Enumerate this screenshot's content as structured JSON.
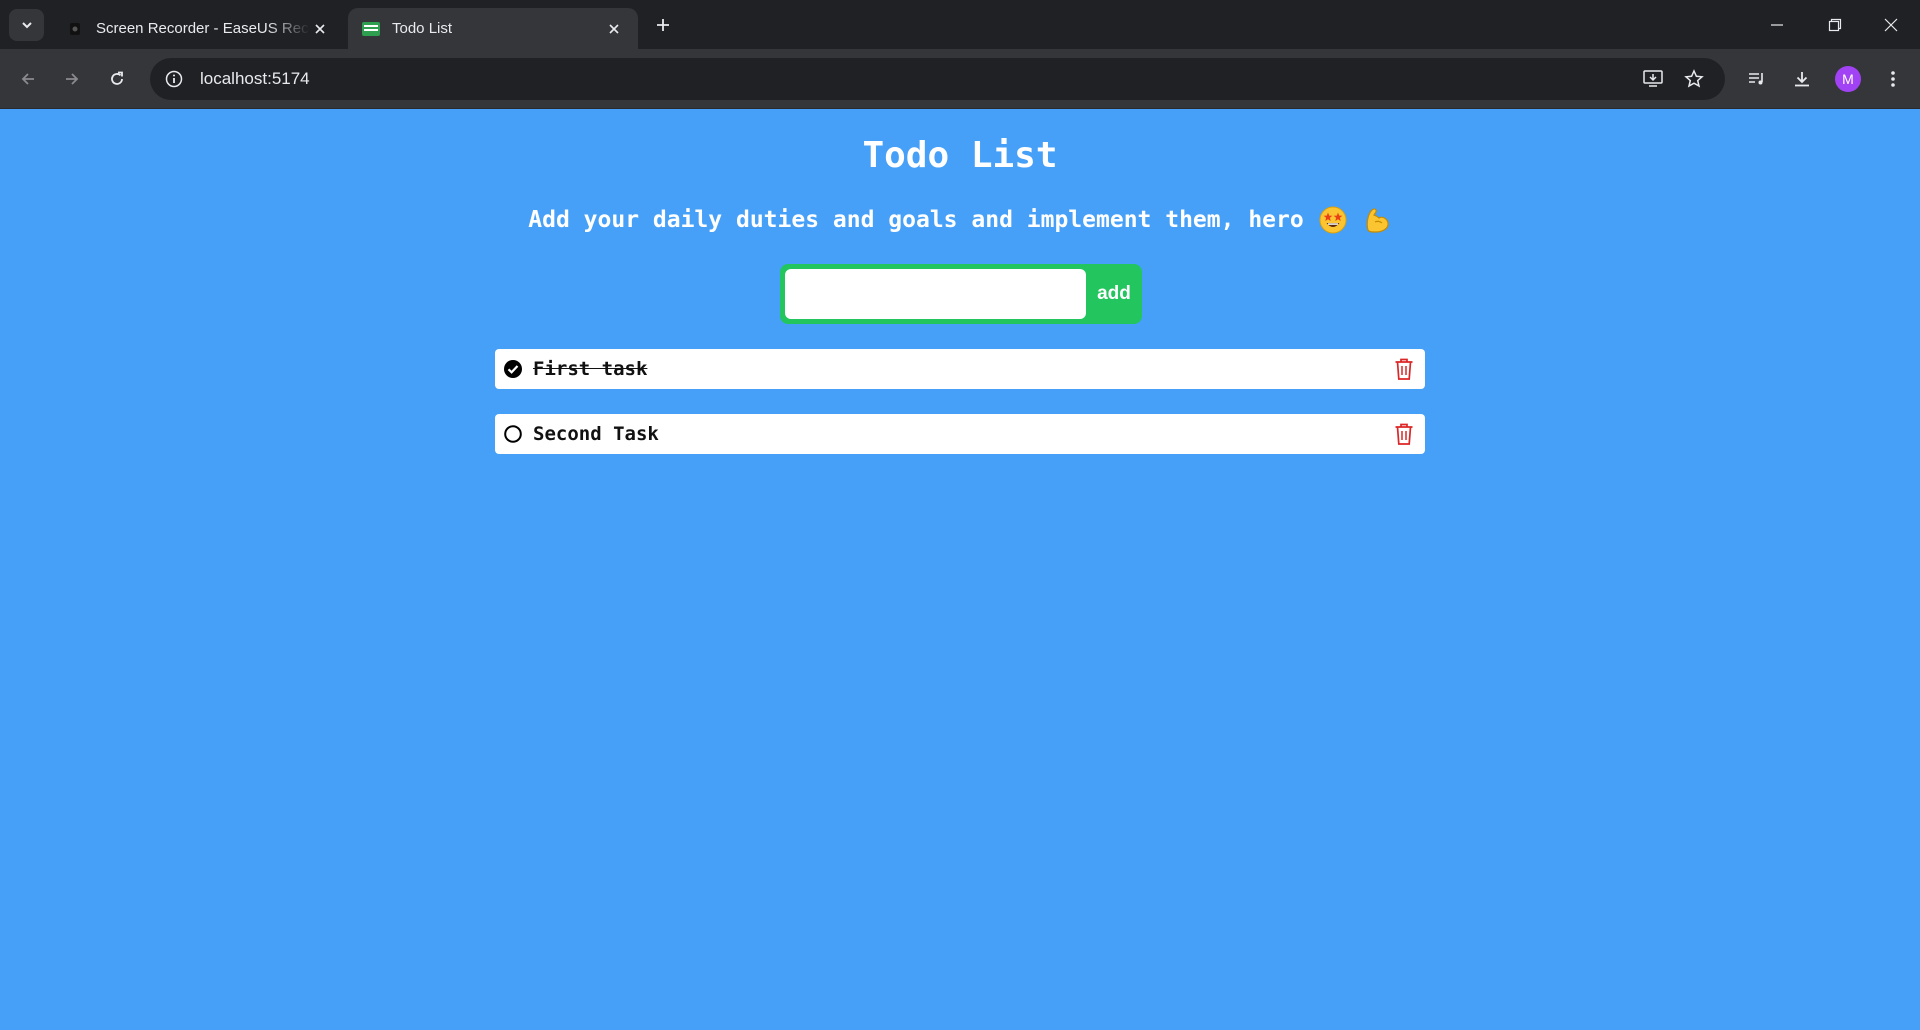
{
  "browser": {
    "tabs": [
      {
        "title": "Screen Recorder - EaseUS RecExperts",
        "active": false,
        "icon": "recorder-icon"
      },
      {
        "title": "Todo List",
        "active": true,
        "icon": "todo-list-favicon"
      }
    ],
    "url": "localhost:5174",
    "profile_initial": "M"
  },
  "app": {
    "title": "Todo List",
    "subtitle": "Add your daily duties and goals and implement them, hero",
    "emojis": [
      "star-struck-emoji",
      "flexed-biceps-emoji"
    ],
    "input": {
      "value": "",
      "placeholder": ""
    },
    "add_label": "add",
    "tasks": [
      {
        "text": "First task",
        "done": true
      },
      {
        "text": "Second Task",
        "done": false
      }
    ]
  },
  "colors": {
    "background": "#47a0f8",
    "accent_green": "#22c55e",
    "delete_red": "#dc2626"
  }
}
